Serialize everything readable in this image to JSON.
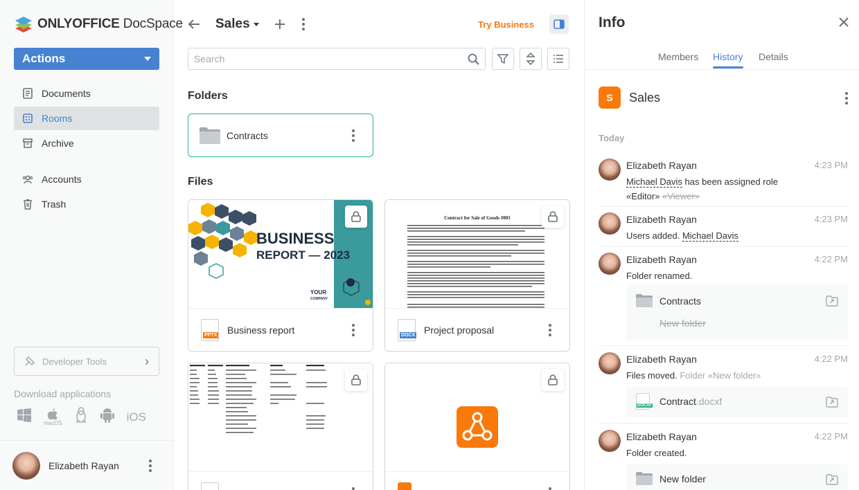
{
  "brand": {
    "bold": "ONLYOFFICE",
    "light": "DocSpace"
  },
  "sidebar": {
    "actions_label": "Actions",
    "items": [
      {
        "label": "Documents",
        "icon": "documents-icon"
      },
      {
        "label": "Rooms",
        "icon": "rooms-icon",
        "active": true
      },
      {
        "label": "Archive",
        "icon": "archive-icon"
      },
      {
        "label": "Accounts",
        "icon": "accounts-icon"
      },
      {
        "label": "Trash",
        "icon": "trash-icon"
      }
    ],
    "developer_tools_label": "Developer Tools",
    "download_title": "Download applications",
    "download_platforms": [
      "windows-icon",
      "macos-icon",
      "linux-icon",
      "android-icon"
    ],
    "macos_label": "macOS",
    "ios_label": "iOS",
    "user_name": "Elizabeth Rayan"
  },
  "header": {
    "room_title": "Sales",
    "try_business": "Try Business"
  },
  "search": {
    "placeholder": "Search"
  },
  "folders": {
    "title": "Folders",
    "items": [
      {
        "name": "Contracts"
      }
    ]
  },
  "files": {
    "title": "Files",
    "items": [
      {
        "name": "Business report",
        "type_tag": "PPTX",
        "thumb_title": "BUSINESS",
        "thumb_subtitle": "REPORT — 2023",
        "thumb_company_top": "YOUR",
        "thumb_company_bottom": "COMPANY"
      },
      {
        "name": "Project proposal",
        "type_tag": "DOCX",
        "thumb_title": "Contract for Sale of Goods #001"
      },
      {
        "name": "",
        "type_tag": ""
      },
      {
        "name": "",
        "type_tag": ""
      }
    ]
  },
  "info": {
    "title": "Info",
    "tabs": [
      "Members",
      "History",
      "Details"
    ],
    "active_tab": "History",
    "room_badge": "S",
    "room_name": "Sales",
    "day_label": "Today",
    "history": [
      {
        "user": "Elizabeth Rayan",
        "time": "4:23 PM",
        "target": "Michael Davis",
        "text": "has been assigned role",
        "role_new": "«Editor»",
        "role_old": "«Viewer»"
      },
      {
        "user": "Elizabeth Rayan",
        "time": "4:23 PM",
        "text": "Users added.",
        "target": "Michael Davis"
      },
      {
        "user": "Elizabeth Rayan",
        "time": "4:22 PM",
        "text": "Folder renamed.",
        "new_name": "Contracts",
        "old_name": "New folder"
      },
      {
        "user": "Elizabeth Rayan",
        "time": "4:22 PM",
        "text": "Files moved.",
        "dest": "Folder «New folder»",
        "file_base": "Contract",
        "file_ext": ".docxf",
        "file_tag": "DOCXF"
      },
      {
        "user": "Elizabeth Rayan",
        "time": "4:22 PM",
        "text": "Folder created.",
        "folder": "New folder"
      }
    ]
  },
  "colors": {
    "accent": "#4781d1",
    "orange": "#f97a0b",
    "green": "#2db482"
  }
}
